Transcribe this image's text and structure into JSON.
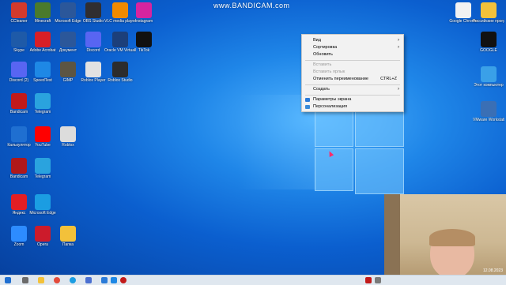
{
  "watermark": "www.BANDICAM.com",
  "desktop": {
    "left_icons": [
      {
        "label": "CCleaner",
        "icon": "ccleaner-icon",
        "color": "#d43a2c"
      },
      {
        "label": "Minecraft",
        "icon": "minecraft-icon",
        "color": "#4a7a2c"
      },
      {
        "label": "Microsoft Edge",
        "icon": "word-icon",
        "color": "#2b579a"
      },
      {
        "label": "OBS Studio",
        "icon": "obs-icon",
        "color": "#302e31"
      },
      {
        "label": "VLC media player",
        "icon": "vlc-icon",
        "color": "#f08a00"
      },
      {
        "label": "Instagram",
        "icon": "instagram-icon",
        "color": "#d6249f"
      },
      {
        "label": "Skype",
        "icon": "skype-icon",
        "color": "#1e5aa8"
      },
      {
        "label": "Adobe Acrobat",
        "icon": "acrobat-icon",
        "color": "#d81f26"
      },
      {
        "label": "Документ",
        "icon": "document-icon",
        "color": "#2b579a"
      },
      {
        "label": "Discord",
        "icon": "discord-icon",
        "color": "#5865f2"
      },
      {
        "label": "Oracle VM VirtualBox",
        "icon": "virtualbox-icon",
        "color": "#1c3f7a"
      },
      {
        "label": "TikTok",
        "icon": "tiktok-icon",
        "color": "#111111"
      },
      {
        "label": "Discord (2)",
        "icon": "discord-icon",
        "color": "#5865f2"
      },
      {
        "label": "SpeedTest",
        "icon": "speedtest-icon",
        "color": "#1e88e5"
      },
      {
        "label": "GIMP",
        "icon": "gimp-icon",
        "color": "#5c5543"
      },
      {
        "label": "Roblox Player",
        "icon": "roblox-icon",
        "color": "#e2e2e2"
      },
      {
        "label": "Roblox Studio",
        "icon": "roblox-studio-icon",
        "color": "#2c2c2c"
      },
      {
        "label": "Bandicam",
        "icon": "bandicam-icon",
        "color": "#c21a1a"
      },
      {
        "label": "Telegram",
        "icon": "telegram-icon",
        "color": "#2aa3de"
      },
      {
        "label": "Калькулятор",
        "icon": "calculator-icon",
        "color": "#1f6fd1"
      },
      {
        "label": "YouTube",
        "icon": "youtube-icon",
        "color": "#ff0000"
      },
      {
        "label": "Roblox",
        "icon": "roblox-icon",
        "color": "#dcdcdc"
      },
      {
        "label": "Bandicam",
        "icon": "bandicam-icon",
        "color": "#b0181a"
      },
      {
        "label": "Telegram",
        "icon": "telegram-icon",
        "color": "#2aa3de"
      },
      {
        "label": "Яндекс",
        "icon": "yandex-icon",
        "color": "#e31e24"
      },
      {
        "label": "Microsoft Edge",
        "icon": "edge-icon",
        "color": "#1b9de2"
      },
      {
        "label": "Zoom",
        "icon": "zoom-icon",
        "color": "#2d8cff"
      },
      {
        "label": "Opera",
        "icon": "opera-icon",
        "color": "#cc1b2b"
      },
      {
        "label": "Папка",
        "icon": "folder-icon",
        "color": "#f3c13a"
      }
    ],
    "right_icons": [
      {
        "label": "Google Chrome",
        "icon": "chrome-icon",
        "color": "#f2f2f2"
      },
      {
        "label": "Российские программы",
        "icon": "folder-icon",
        "color": "#f3c13a"
      },
      {
        "label": "GOOGLE",
        "icon": "google-icon",
        "color": "#111111"
      },
      {
        "label": "Этот компьютер",
        "icon": "computer-icon",
        "color": "#3aa0e8"
      },
      {
        "label": "VMware Workstati...",
        "icon": "vmware-icon",
        "color": "#3a6fb5"
      }
    ]
  },
  "context_menu": {
    "items": [
      {
        "label": "Вид",
        "arrow": "›",
        "disabled": false
      },
      {
        "label": "Сортировка",
        "arrow": "›",
        "disabled": false
      },
      {
        "label": "Обновить",
        "disabled": false
      },
      {
        "label": "Вставить",
        "disabled": true
      },
      {
        "label": "Вставить ярлык",
        "disabled": true
      },
      {
        "label": "Отменить переименование",
        "shortcut": "CTRL+Z",
        "disabled": false
      },
      {
        "label": "Создать",
        "arrow": "›",
        "disabled": false
      },
      {
        "label": "Параметры экрана",
        "disabled": false
      },
      {
        "label": "Персонализация",
        "disabled": false
      }
    ]
  },
  "webcam": {
    "date": "12.08.2023"
  },
  "taskbar": {
    "items": [
      "windows-start-icon",
      "task-view-icon",
      "explorer-icon",
      "chrome-icon",
      "edge-icon",
      "store-icon",
      "mail-icon",
      "photos-icon",
      "bandicam-icon"
    ]
  }
}
